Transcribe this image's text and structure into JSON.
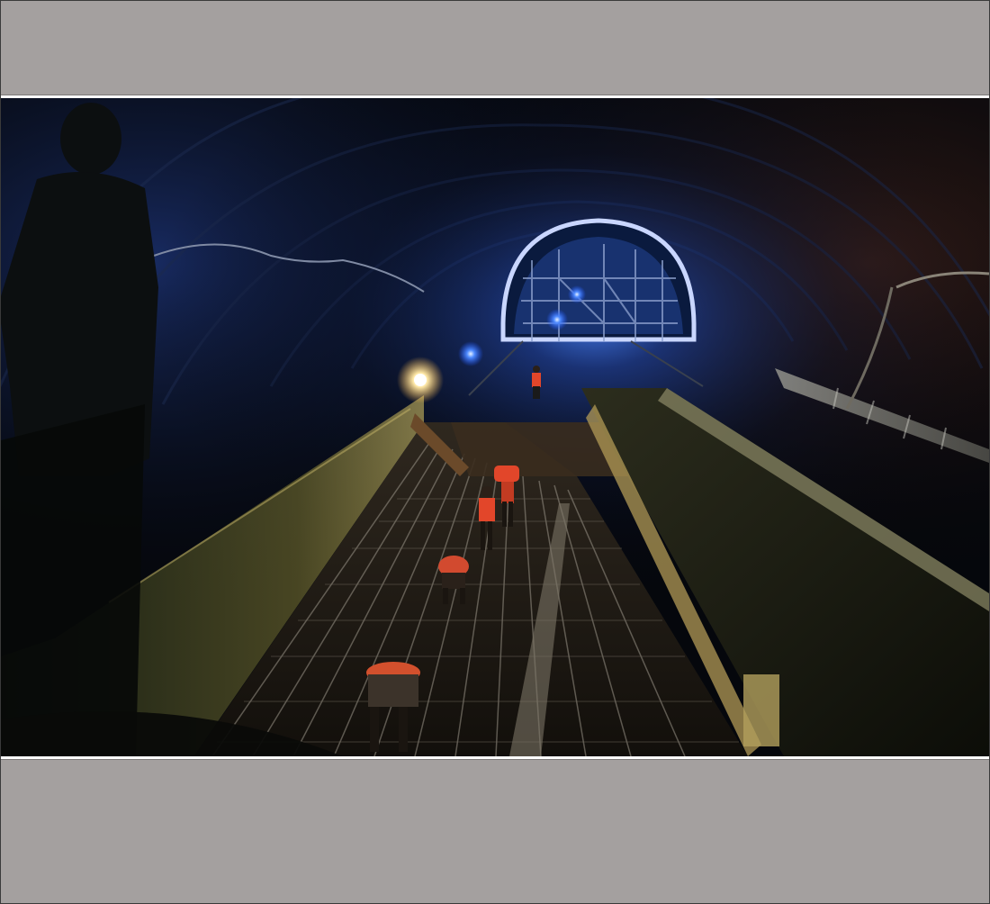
{
  "image": {
    "subject": "tunnel-construction-photo",
    "colors": {
      "band": "#a4a09f",
      "tunnel_dark": "#05070c",
      "light_blue": "#3f7bff",
      "light_warm": "#ffd98a",
      "safety_orange": "#e2462a"
    }
  }
}
